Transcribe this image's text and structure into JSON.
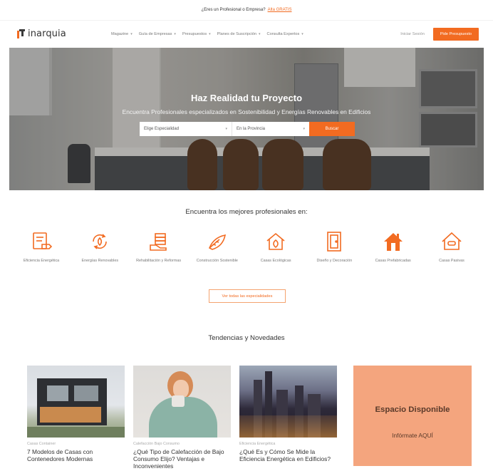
{
  "topbar": {
    "text": "¿Eres un Profesional o Empresa?",
    "link": "Alta GRATIS"
  },
  "header": {
    "logo_text": "inarquia",
    "nav": [
      {
        "label": "Magazine"
      },
      {
        "label": "Guía de Empresas"
      },
      {
        "label": "Presupuestos"
      },
      {
        "label": "Planes de Suscripción"
      },
      {
        "label": "Consulta Expertos"
      }
    ],
    "login": "Iniciar Sesión",
    "cta": "Pide Presupuesto"
  },
  "hero": {
    "title": "Haz Realidad tu Proyecto",
    "subtitle": "Encuentra Profesionales especializados en Sostenibilidad y Energías Renovables en Edificios",
    "select_specialty": "Elige Especialidad",
    "select_province": "En la Provincia",
    "search_button": "Buscar"
  },
  "professionals": {
    "heading": "Encuentra los mejores profesionales en:",
    "categories": [
      {
        "label": "Eficiencia Energética",
        "icon": "energy-certificate-icon"
      },
      {
        "label": "Energías Renovables",
        "icon": "renewable-cycle-icon"
      },
      {
        "label": "Rehabilitación y Reformas",
        "icon": "renovation-bricks-icon"
      },
      {
        "label": "Construcción Sostenible",
        "icon": "sustainable-leaf-icon"
      },
      {
        "label": "Casas Ecológicas",
        "icon": "eco-house-icon"
      },
      {
        "label": "Diseño y Decoración",
        "icon": "design-door-icon"
      },
      {
        "label": "Casas Prefabricadas",
        "icon": "prefab-house-icon"
      },
      {
        "label": "Casas Pasivas",
        "icon": "passive-house-icon"
      }
    ],
    "more_button": "Ver todas las especialidades"
  },
  "news": {
    "heading": "Tendencias y Novedades",
    "cards": [
      {
        "category": "Casas Container",
        "title": "7 Modelos de Casas con Contenedores Modernas"
      },
      {
        "category": "Calefacción Bajo Consumo",
        "title": "¿Qué Tipo de Calefacción de Bajo Consumo Elijo? Ventajas e Inconvenientes"
      },
      {
        "category": "Eficiencia Energética",
        "title": "¿Qué Es y Cómo Se Mide la Eficiencia Energética en Edificios?"
      }
    ],
    "promo_title": "Espacio Disponible",
    "promo_sub": "Infórmate AQUÍ"
  },
  "colors": {
    "accent": "#f26b21",
    "promo_bg": "#f4a57e",
    "text": "#333333"
  }
}
